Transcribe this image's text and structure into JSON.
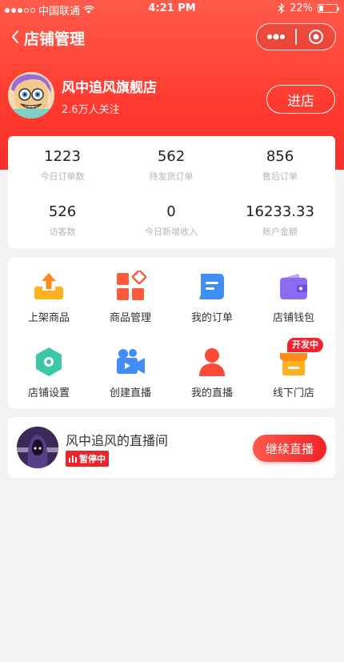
{
  "status_bar": {
    "carrier": "中国联通",
    "time": "4:21 PM",
    "battery": "22%",
    "battery_level": 0.22
  },
  "nav": {
    "title": "店铺管理"
  },
  "shop": {
    "name": "风中追风旗舰店",
    "followers": "2.6万人关注",
    "enter_label": "进店"
  },
  "stats": [
    {
      "value": "1223",
      "label": "今日订单数"
    },
    {
      "value": "562",
      "label": "待发货订单"
    },
    {
      "value": "856",
      "label": "售后订单"
    },
    {
      "value": "526",
      "label": "访客数"
    },
    {
      "value": "0",
      "label": "今日新增收入"
    },
    {
      "value": "16233.33",
      "label": "账户金额"
    }
  ],
  "menu": [
    {
      "label": "上架商品",
      "icon": "upload-icon"
    },
    {
      "label": "商品管理",
      "icon": "grid-icon"
    },
    {
      "label": "我的订单",
      "icon": "order-icon"
    },
    {
      "label": "店铺钱包",
      "icon": "wallet-icon"
    },
    {
      "label": "店铺设置",
      "icon": "settings-icon"
    },
    {
      "label": "创建直播",
      "icon": "video-camera-icon"
    },
    {
      "label": "我的直播",
      "icon": "person-icon"
    },
    {
      "label": "线下门店",
      "icon": "store-icon"
    }
  ],
  "menu_badge": "开发中",
  "live": {
    "name": "风中追风的直播间",
    "status": "暂停中",
    "button": "继续直播"
  },
  "colors": {
    "brand_red": "#ff3b30",
    "orange": "#ff9a1f",
    "blue": "#3f8df5",
    "purple": "#8a6cf0",
    "teal": "#3cc8a8"
  }
}
